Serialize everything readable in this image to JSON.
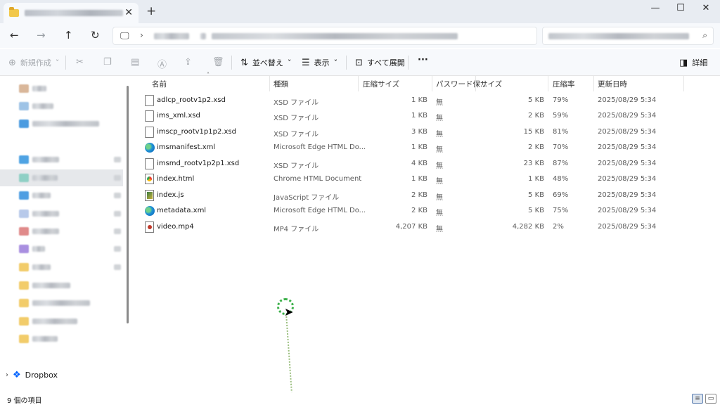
{
  "window": {
    "new_tab": "+",
    "minimize": "—",
    "maximize": "☐",
    "close": "✕",
    "tab_close": "✕"
  },
  "toolbar": {
    "new_label": "新規作成",
    "sort_label": "並べ替え",
    "view_label": "表示",
    "expand_all_label": "すべて展開",
    "more_label": "···",
    "details_label": "詳細"
  },
  "sidebar": {
    "dropbox_label": "Dropbox"
  },
  "columns": {
    "name": "名前",
    "type": "種類",
    "compressed": "圧縮サイズ",
    "password": "パスワード保...",
    "size": "サイズ",
    "ratio": "圧縮率",
    "date": "更新日時"
  },
  "files": [
    {
      "name": "adlcp_rootv1p2.xsd",
      "type": "XSD ファイル",
      "compressed": "1 KB",
      "password": "無",
      "size": "5 KB",
      "ratio": "79%",
      "date": "2025/08/29 5:34",
      "icon": "doc"
    },
    {
      "name": "ims_xml.xsd",
      "type": "XSD ファイル",
      "compressed": "1 KB",
      "password": "無",
      "size": "2 KB",
      "ratio": "59%",
      "date": "2025/08/29 5:34",
      "icon": "doc"
    },
    {
      "name": "imscp_rootv1p1p2.xsd",
      "type": "XSD ファイル",
      "compressed": "3 KB",
      "password": "無",
      "size": "15 KB",
      "ratio": "81%",
      "date": "2025/08/29 5:34",
      "icon": "doc"
    },
    {
      "name": "imsmanifest.xml",
      "type": "Microsoft Edge HTML Do...",
      "compressed": "1 KB",
      "password": "無",
      "size": "2 KB",
      "ratio": "70%",
      "date": "2025/08/29 5:34",
      "icon": "edge"
    },
    {
      "name": "imsmd_rootv1p2p1.xsd",
      "type": "XSD ファイル",
      "compressed": "4 KB",
      "password": "無",
      "size": "23 KB",
      "ratio": "87%",
      "date": "2025/08/29 5:34",
      "icon": "doc"
    },
    {
      "name": "index.html",
      "type": "Chrome HTML Document",
      "compressed": "1 KB",
      "password": "無",
      "size": "1 KB",
      "ratio": "48%",
      "date": "2025/08/29 5:34",
      "icon": "chrome"
    },
    {
      "name": "index.js",
      "type": "JavaScript ファイル",
      "compressed": "2 KB",
      "password": "無",
      "size": "5 KB",
      "ratio": "69%",
      "date": "2025/08/29 5:34",
      "icon": "js"
    },
    {
      "name": "metadata.xml",
      "type": "Microsoft Edge HTML Do...",
      "compressed": "2 KB",
      "password": "無",
      "size": "5 KB",
      "ratio": "75%",
      "date": "2025/08/29 5:34",
      "icon": "edge"
    },
    {
      "name": "video.mp4",
      "type": "MP4 ファイル",
      "compressed": "4,207 KB",
      "password": "無",
      "size": "4,282 KB",
      "ratio": "2%",
      "date": "2025/08/29 5:34",
      "icon": "video"
    }
  ],
  "status": {
    "item_count": "9 個の項目"
  }
}
